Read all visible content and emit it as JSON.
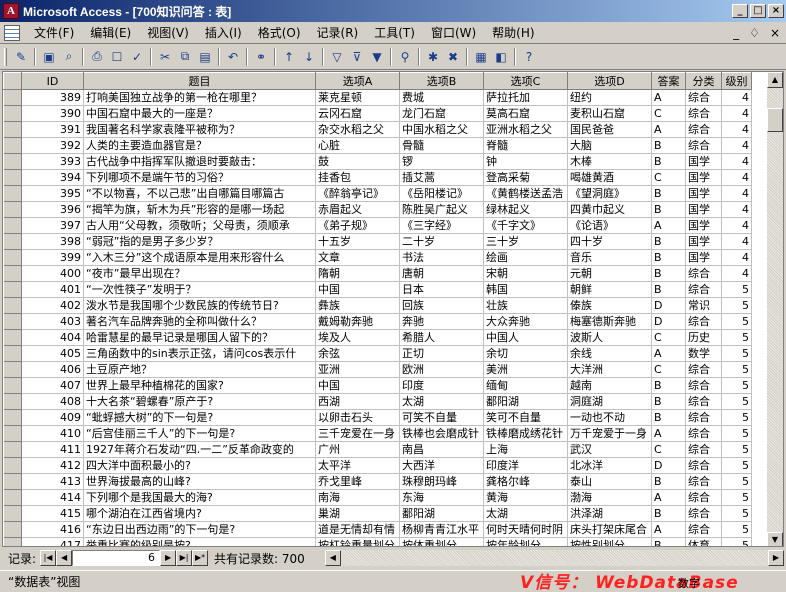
{
  "window": {
    "title": "Microsoft Access - [700知识问答 : 表]",
    "app_icon": "A"
  },
  "menu": [
    "文件(F)",
    "编辑(E)",
    "视图(V)",
    "插入(I)",
    "格式(O)",
    "记录(R)",
    "工具(T)",
    "窗口(W)",
    "帮助(H)"
  ],
  "menu_right": [
    "_",
    "♢",
    "×"
  ],
  "columns": [
    "ID",
    "题目",
    "选项A",
    "选项B",
    "选项C",
    "选项D",
    "答案",
    "分类",
    "级别"
  ],
  "rows": [
    [
      "389",
      "打响美国独立战争的第一枪在哪里？",
      "莱克星顿",
      "费城",
      "萨拉托加",
      "纽约",
      "A",
      "综合",
      "4"
    ],
    [
      "390",
      "中国石窟中最大的一座是？",
      "云冈石窟",
      "龙门石窟",
      "莫高石窟",
      "麦积山石窟",
      "C",
      "综合",
      "4"
    ],
    [
      "391",
      "我国著名科学家袁隆平被称为？",
      "杂交水稻之父",
      "中国水稻之父",
      "亚洲水稻之父",
      "国民爸爸",
      "A",
      "综合",
      "4"
    ],
    [
      "392",
      "人类的主要造血器官是？",
      "心脏",
      "骨髓",
      "脊髓",
      "大脑",
      "B",
      "综合",
      "4"
    ],
    [
      "393",
      "古代战争中指挥军队撤退时要敲击：",
      "鼓",
      "锣",
      "钟",
      "木棒",
      "B",
      "国学",
      "4"
    ],
    [
      "394",
      "下列哪项不是端午节的习俗？",
      "挂香包",
      "插艾蒿",
      "登高采菊",
      "喝雄黄酒",
      "C",
      "国学",
      "4"
    ],
    [
      "395",
      "“不以物喜，不以己悲”出自哪篇目哪篇古",
      "《醉翁亭记》",
      "《岳阳楼记》",
      "《黄鹤楼送孟浩",
      "《望洞庭》",
      "B",
      "国学",
      "4"
    ],
    [
      "396",
      "“揭竿为旗，斩木为兵”形容的是哪一场起",
      "赤眉起义",
      "陈胜吴广起义",
      "绿林起义",
      "四黄巾起义",
      "B",
      "国学",
      "4"
    ],
    [
      "397",
      "古人用“父母教，须敬听；父母责，须顺承",
      "《弟子规》",
      "《三字经》",
      "《千字文》",
      "《论语》",
      "A",
      "国学",
      "4"
    ],
    [
      "398",
      "“弱冠”指的是男子多少岁？",
      "十五岁",
      "二十岁",
      "三十岁",
      "四十岁",
      "B",
      "国学",
      "4"
    ],
    [
      "399",
      "“入木三分”这个成语原本是用来形容什么",
      "文章",
      "书法",
      "绘画",
      "音乐",
      "B",
      "国学",
      "4"
    ],
    [
      "400",
      "“夜市”最早出现在？",
      "隋朝",
      "唐朝",
      "宋朝",
      "元朝",
      "B",
      "综合",
      "4"
    ],
    [
      "401",
      "“一次性筷子”发明于？",
      "中国",
      "日本",
      "韩国",
      "朝鲜",
      "B",
      "综合",
      "5"
    ],
    [
      "402",
      "泼水节是我国哪个少数民族的传统节日?",
      "彝族",
      "回族",
      "壮族",
      "傣族",
      "D",
      "常识",
      "5"
    ],
    [
      "403",
      "著名汽车品牌奔驰的全称叫做什么？",
      "戴姆勒奔驰",
      "奔驰",
      "大众奔驰",
      "梅塞德斯奔驰",
      "D",
      "综合",
      "5"
    ],
    [
      "404",
      "哈雷慧星的最早记录是哪国人留下的？",
      "埃及人",
      "希腊人",
      "中国人",
      "波斯人",
      "C",
      "历史",
      "5"
    ],
    [
      "405",
      "三角函数中的sin表示正弦，请问cos表示什",
      "余弦",
      "正切",
      "余切",
      "余线",
      "A",
      "数学",
      "5"
    ],
    [
      "406",
      "土豆原产地？",
      "亚洲",
      "欧洲",
      "美洲",
      "大洋洲",
      "C",
      "综合",
      "5"
    ],
    [
      "407",
      "世界上最早种植棉花的国家?",
      "中国",
      "印度",
      "缅甸",
      "越南",
      "B",
      "综合",
      "5"
    ],
    [
      "408",
      "十大名茶“碧螺春”原产于?",
      "西湖",
      "太湖",
      "鄱阳湖",
      "洞庭湖",
      "B",
      "综合",
      "5"
    ],
    [
      "409",
      "“蚍蜉撼大树”的下一句是?",
      "以卵击石头",
      "可笑不自量",
      "笑可不自量",
      "一动也不动",
      "B",
      "综合",
      "5"
    ],
    [
      "410",
      "“后宫佳丽三千人”的下一句是?",
      "三千宠爱在一身",
      "铁棒也会磨成针",
      "铁棒磨成绣花针",
      "万千宠爱于一身",
      "A",
      "综合",
      "5"
    ],
    [
      "411",
      "1927年蒋介石发动“四.一二”反革命政变的",
      "广州",
      "南昌",
      "上海",
      "武汉",
      "C",
      "综合",
      "5"
    ],
    [
      "412",
      "四大洋中面积最小的?",
      "太平洋",
      "大西洋",
      "印度洋",
      "北冰洋",
      "D",
      "综合",
      "5"
    ],
    [
      "413",
      "世界海拔最高的山峰?",
      "乔戈里峰",
      "珠穆朗玛峰",
      "龚格尔峰",
      "泰山",
      "B",
      "综合",
      "5"
    ],
    [
      "414",
      "下列哪个是我国最大的海?",
      "南海",
      "东海",
      "黄海",
      "渤海",
      "A",
      "综合",
      "5"
    ],
    [
      "415",
      "哪个湖泊在江西省境内?",
      "巢湖",
      "鄱阳湖",
      "太湖",
      "洪泽湖",
      "B",
      "综合",
      "5"
    ],
    [
      "416",
      "“东边日出西边雨”的下一句是?",
      "道是无情却有情",
      "杨柳青青江水平",
      "何时天晴何时阴",
      "床头打架床尾合",
      "A",
      "综合",
      "5"
    ],
    [
      "417",
      "举重比赛的级别是按?",
      "按杠铃重量划分",
      "按体重划分",
      "按年龄划分",
      "按性别划分",
      "B",
      "体育",
      "5"
    ]
  ],
  "nav": {
    "label": "记录:",
    "current": "6",
    "total": "共有记录数: 700"
  },
  "status": {
    "text": "“数据表”视图",
    "watermark": "V信号： WebDataBase",
    "mode": "数字"
  }
}
